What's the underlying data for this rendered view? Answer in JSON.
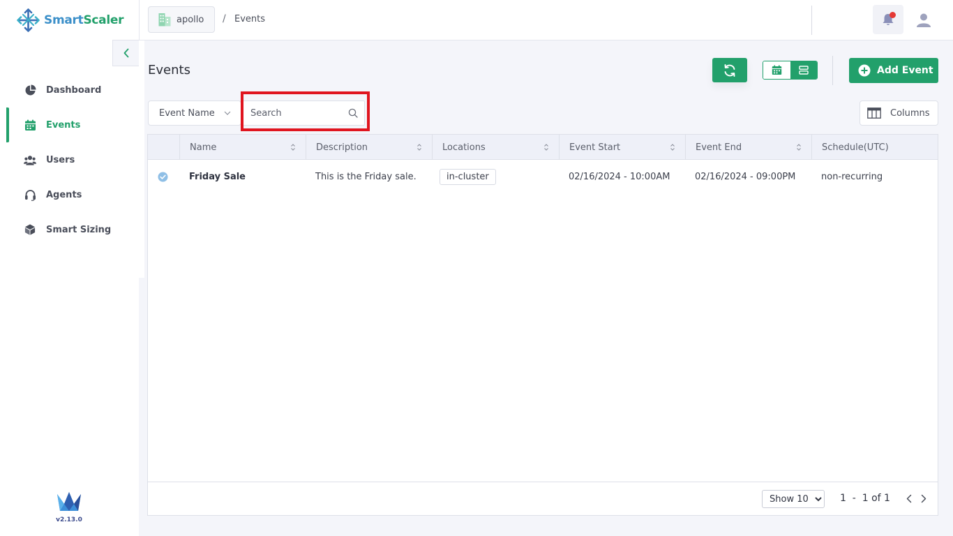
{
  "brand": {
    "name_part1": "Smart",
    "name_part2": "Scaler",
    "version": "v2.13.0"
  },
  "colors": {
    "accent": "#22a06b",
    "highlight": "#e0151f",
    "brand_blue": "#3b8fc9",
    "notification_dot": "#e53935"
  },
  "sidebar": {
    "items": [
      {
        "label": "Dashboard",
        "icon": "pie-chart-icon",
        "active": false
      },
      {
        "label": "Events",
        "icon": "calendar-icon",
        "active": true
      },
      {
        "label": "Users",
        "icon": "users-icon",
        "active": false
      },
      {
        "label": "Agents",
        "icon": "headset-icon",
        "active": false
      },
      {
        "label": "Smart Sizing",
        "icon": "cube-icon",
        "active": false
      }
    ]
  },
  "breadcrumb": {
    "workspace": "apollo",
    "separator": "/",
    "current": "Events"
  },
  "page": {
    "title": "Events"
  },
  "toolbar": {
    "add_label": "Add Event",
    "columns_label": "Columns"
  },
  "filter": {
    "field": "Event Name",
    "search_placeholder": "Search"
  },
  "table": {
    "columns": [
      "Name",
      "Description",
      "Locations",
      "Event Start",
      "Event End",
      "Schedule(UTC)"
    ],
    "rows": [
      {
        "selected": true,
        "name": "Friday Sale",
        "description": "This is the Friday sale.",
        "location": "in-cluster",
        "start": "02/16/2024 - 10:00AM",
        "end": "02/16/2024 - 09:00PM",
        "schedule": "non-recurring"
      }
    ]
  },
  "pagination": {
    "page_size": "Show 10",
    "range": "1  -  1 of 1"
  }
}
